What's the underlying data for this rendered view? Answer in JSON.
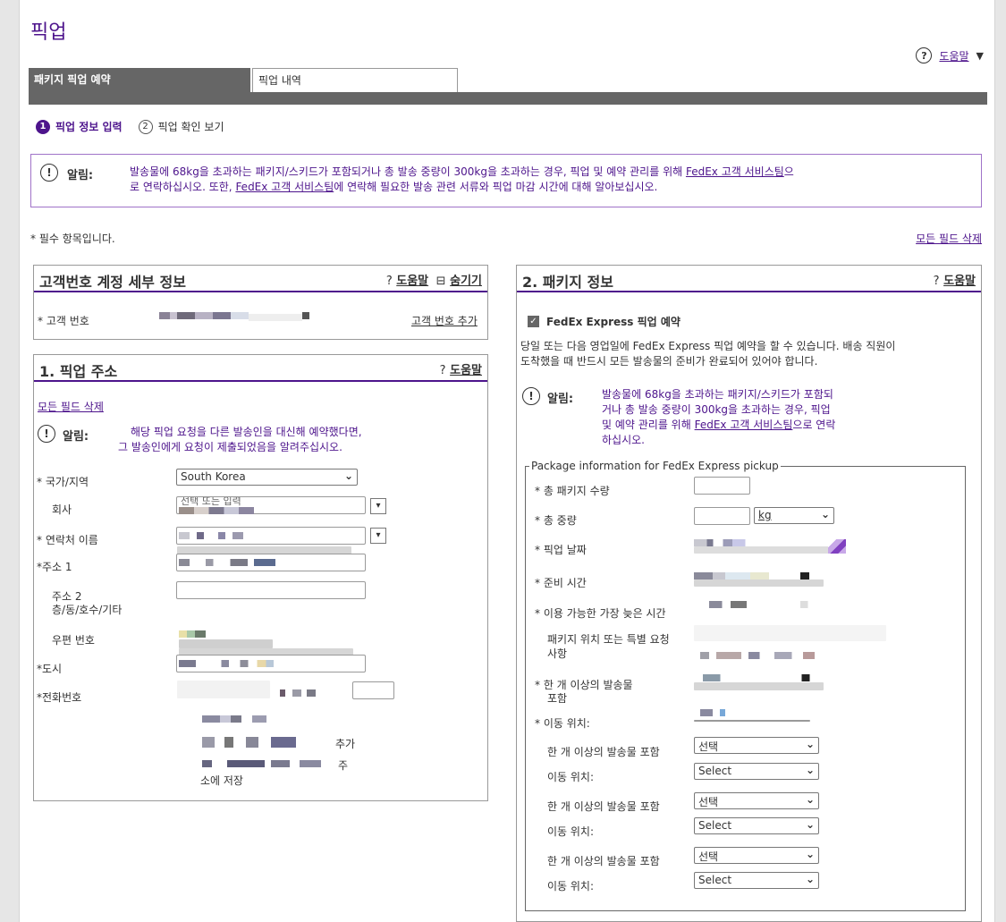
{
  "page": {
    "title": "픽업",
    "help_label": "도움말"
  },
  "tabs": [
    {
      "label": "패키지 픽업 예약",
      "active": true
    },
    {
      "label": "픽업 내역",
      "active": false
    }
  ],
  "steps": [
    {
      "num": "1",
      "label": "픽업 정보 입력",
      "active": true
    },
    {
      "num": "2",
      "label": "픽업 확인 보기",
      "active": false
    }
  ],
  "top_alert": {
    "label": "알림:",
    "line1_pre": "발송물에 68kg을 초과하는 패키지/스키드가 포함되거나 총 발송 중량이 300kg을 초과하는 경우, 픽업 및 예약 관리를 위해 ",
    "link1": "FedEx 고객 서비스팀",
    "line1_post": "으",
    "line2_pre": "로 연락하십시오. 또한, ",
    "link2": "FedEx 고객 서비스팀",
    "line2_post": "에 연락해 필요한 발송 관련 서류와 픽업 마감 시간에 대해 알아보십시오."
  },
  "required_note": "* 필수 항목입니다.",
  "clear_all": "모든 필드 삭제",
  "account_panel": {
    "title": "고객번호 계정 세부 정보",
    "help": "도움말",
    "hide": "숨기기",
    "account_label": "* 고객 번호",
    "add_account": "고객 번호 추가"
  },
  "pickup_address": {
    "title": "1. 픽업 주소",
    "help": "도움말",
    "clear_all": "모든 필드 삭제",
    "alert_label": "알림:",
    "alert_line1": "해당 픽업 요청을 다른 발송인을 대신해 예약했다면,",
    "alert_line2": "그 발송인에게 요청이 제출되었음을 알려주십시오.",
    "country_label": "* 국가/지역",
    "country_value": "South Korea",
    "company_label": "회사",
    "company_placeholder": "선택 또는 입력",
    "contact_label": "* 연락처 이름",
    "address1_label": "*주소 1",
    "address2_label": "주소 2",
    "address2_sub": "층/동/호수/기타",
    "postal_label": "우편 번호",
    "city_label": "*도시",
    "phone_label": "*전화번호",
    "frag_add": "추가",
    "frag_ju": "주",
    "frag_save": "소에 저장"
  },
  "package_panel": {
    "title": "2. 패키지 정보",
    "help": "도움말",
    "checkbox_label": "FedEx Express 픽업 예약",
    "desc_line1": "당일 또는 다음 영업일에 FedEx Express 픽업 예약을 할 수 있습니다. 배송 직원이",
    "desc_line2": "도착했을 때 반드시 모든 발송물의 준비가 완료되어 있어야 합니다.",
    "alert_label": "알림:",
    "alert_line1": "발송물에 68kg을 초과하는 패키지/스키드가 포함되",
    "alert_line2": "거나 총 발송 중량이 300kg을 초과하는 경우, 픽업",
    "alert_line3_pre": "및 예약 관리를 위해 ",
    "alert_link": "FedEx 고객 서비스팀",
    "alert_line3_post": "으로 연락",
    "alert_line4": "하십시오.",
    "fieldset_legend": "Package information for FedEx Express pickup",
    "total_packages": "* 총 패키지 수량",
    "total_weight": "* 총 중량",
    "weight_unit": "kg",
    "pickup_date": "* 픽업 날짜",
    "ready_time": "* 준비 시간",
    "latest_time": "* 이용 가능한 가장 늦은 시간",
    "location_line1": "패키지 위치 또는 특별 요청",
    "location_line2": "사항",
    "contains_req_line1": "* 한 개 이상의 발송물",
    "contains_req_line2": "포함",
    "move_req": "* 이동 위치:",
    "contains": "한 개 이상의 발송물 포함",
    "move": "이동 위치:",
    "select_ko": "선택",
    "select_en": "Select"
  }
}
